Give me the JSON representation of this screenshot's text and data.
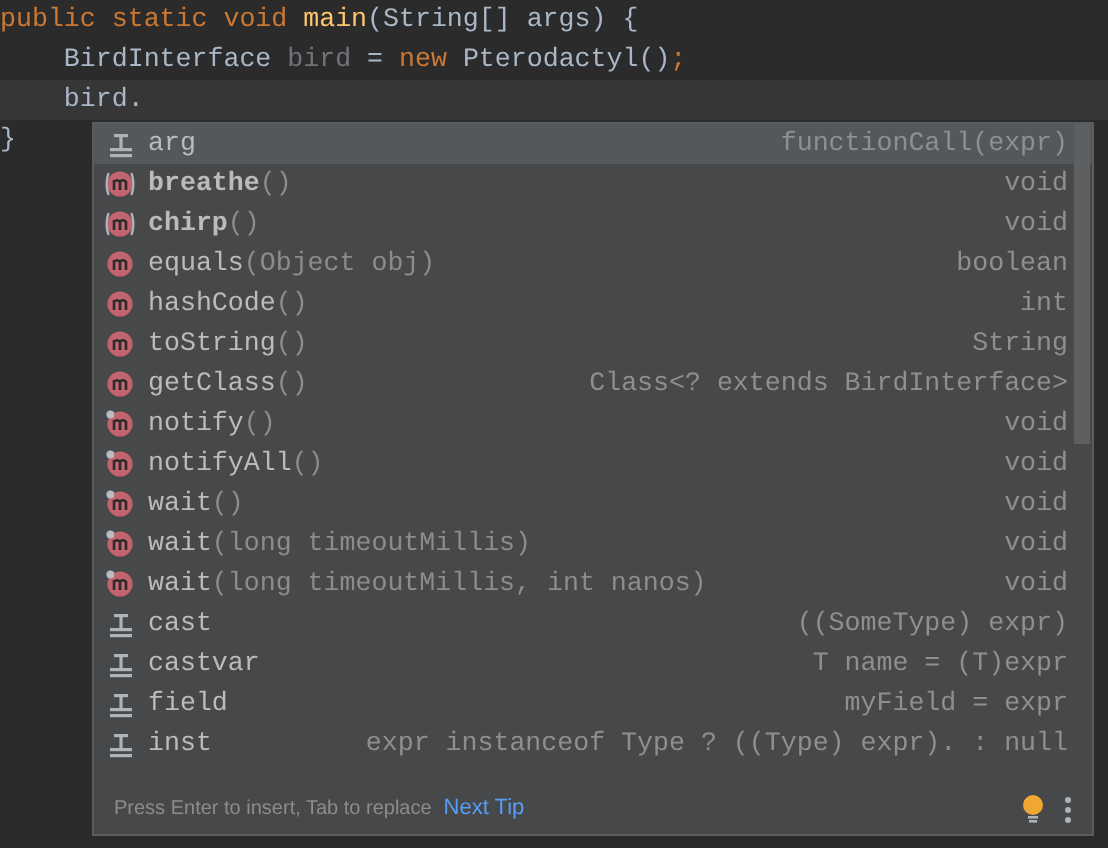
{
  "editor": {
    "lines": [
      {
        "current": false,
        "tokens": [
          {
            "kind": "keyword",
            "text": "public static void "
          },
          {
            "kind": "function",
            "text": "main"
          },
          {
            "kind": "plain",
            "text": "(String[] args) {"
          }
        ]
      },
      {
        "current": false,
        "tokens": [
          {
            "kind": "plain",
            "text": "    BirdInterface "
          },
          {
            "kind": "unused",
            "text": "bird"
          },
          {
            "kind": "plain",
            "text": " = "
          },
          {
            "kind": "keyword",
            "text": "new "
          },
          {
            "kind": "plain",
            "text": "Pterodactyl()"
          },
          {
            "kind": "keyword",
            "text": ";"
          }
        ]
      },
      {
        "current": true,
        "tokens": [
          {
            "kind": "plain",
            "text": "    bird."
          }
        ]
      },
      {
        "current": false,
        "tokens": [
          {
            "kind": "plain",
            "text": "}"
          }
        ]
      }
    ]
  },
  "completion": {
    "items": [
      {
        "kind": "template",
        "name": "arg",
        "type": "functionCall(expr)",
        "selected": true
      },
      {
        "kind": "abstract-method",
        "bold": true,
        "name": "breathe",
        "params": "()",
        "type": "void",
        "selected": false
      },
      {
        "kind": "abstract-method",
        "bold": true,
        "name": "chirp",
        "params": "()",
        "type": "void",
        "selected": false
      },
      {
        "kind": "method",
        "name": "equals",
        "params": "(Object obj)",
        "type": "boolean",
        "selected": false
      },
      {
        "kind": "method",
        "name": "hashCode",
        "params": "()",
        "type": "int",
        "selected": false
      },
      {
        "kind": "method",
        "name": "toString",
        "params": "()",
        "type": "String",
        "selected": false
      },
      {
        "kind": "method",
        "name": "getClass",
        "params": "()",
        "type": "Class<? extends BirdInterface>",
        "selected": false
      },
      {
        "kind": "final-method",
        "name": "notify",
        "params": "()",
        "type": "void",
        "selected": false
      },
      {
        "kind": "final-method",
        "name": "notifyAll",
        "params": "()",
        "type": "void",
        "selected": false
      },
      {
        "kind": "final-method",
        "name": "wait",
        "params": "()",
        "type": "void",
        "selected": false
      },
      {
        "kind": "final-method",
        "name": "wait",
        "params": "(long timeoutMillis)",
        "type": "void",
        "selected": false
      },
      {
        "kind": "final-method",
        "name": "wait",
        "params": "(long timeoutMillis, int nanos)",
        "type": "void",
        "selected": false
      },
      {
        "kind": "template",
        "name": "cast",
        "type": "((SomeType) expr)",
        "selected": false
      },
      {
        "kind": "template",
        "name": "castvar",
        "type": "T name = (T)expr",
        "selected": false
      },
      {
        "kind": "template",
        "name": "field",
        "type": "myField = expr",
        "selected": false
      },
      {
        "kind": "template",
        "name": "inst",
        "type": "expr instanceof Type ? ((Type) expr). : null",
        "selected": false
      }
    ],
    "footer": {
      "hint": "Press Enter to insert, Tab to replace",
      "link": "Next Tip"
    }
  }
}
